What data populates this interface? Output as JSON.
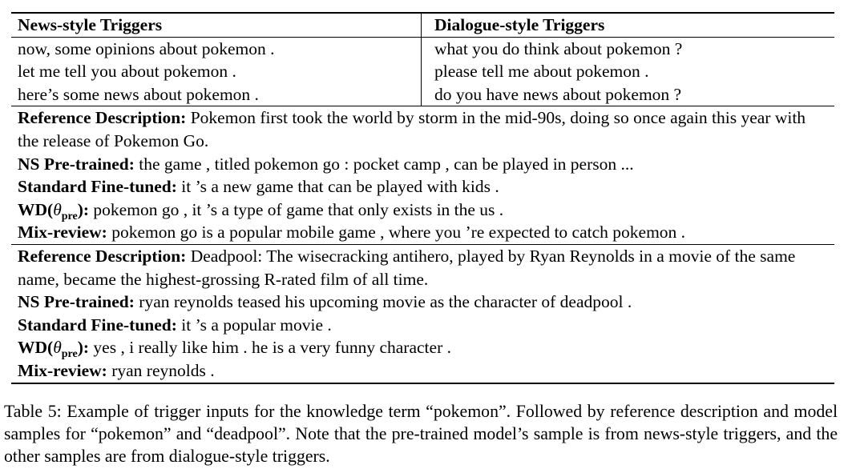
{
  "table": {
    "headers": [
      "News-style Triggers",
      "Dialogue-style Triggers"
    ],
    "rows": [
      [
        "now, some opinions about pokemon .",
        "what you do think about pokemon ?"
      ],
      [
        "let me tell you about pokemon .",
        "please tell me about pokemon ."
      ],
      [
        "here’s some news about pokemon .",
        "do you have news about pokemon ?"
      ]
    ],
    "sections": [
      {
        "ref_label": "Reference Description:",
        "ref_text": "Pokemon first took the world by storm in the mid-90s, doing so once again this year with the release of Pokemon Go.",
        "ns_label": "NS Pre-trained:",
        "ns_text": "the game , titled pokemon go : pocket camp , can be played in person ...",
        "sf_label": "Standard Fine-tuned:",
        "sf_text": "it ’s a new game that can be played with kids .",
        "wd_label_prefix": "WD(",
        "wd_theta": "θ",
        "wd_sub": "pre",
        "wd_label_suffix": "):",
        "wd_text": "pokemon go , it ’s a type of game that only exists in the us .",
        "mr_label": "Mix-review:",
        "mr_text": "pokemon go is a popular mobile game , where you ’re expected to catch pokemon ."
      },
      {
        "ref_label": "Reference Description:",
        "ref_text": "Deadpool: The wisecracking antihero, played by Ryan Reynolds in a movie of the same name, became the highest-grossing R-rated film of all time.",
        "ns_label": "NS Pre-trained:",
        "ns_text": "ryan reynolds teased his upcoming movie as the character of deadpool .",
        "sf_label": "Standard Fine-tuned:",
        "sf_text": "it ’s a popular movie .",
        "wd_label_prefix": "WD(",
        "wd_theta": "θ",
        "wd_sub": "pre",
        "wd_label_suffix": "):",
        "wd_text": "yes , i really like him . he is a very funny character .",
        "mr_label": "Mix-review:",
        "mr_text": "ryan reynolds ."
      }
    ]
  },
  "caption": "Table 5: Example of trigger inputs for the knowledge term “pokemon”. Followed by reference description and model samples for “pokemon” and “deadpool”. Note that the pre-trained model’s sample is from news-style triggers, and the other samples are from dialogue-style triggers."
}
